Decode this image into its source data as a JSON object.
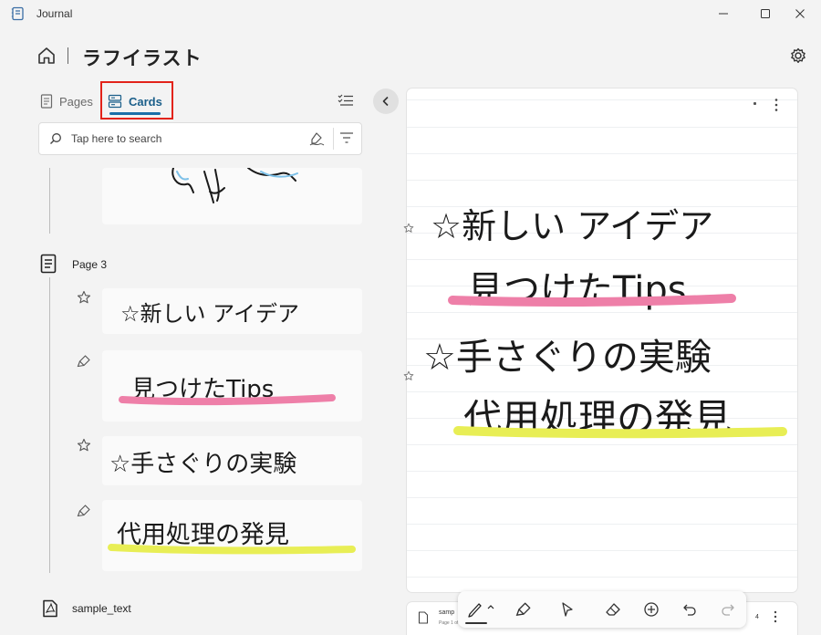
{
  "window": {
    "app_title": "Journal",
    "icons": [
      "journal-app-icon",
      "minimize-icon",
      "maximize-icon",
      "close-icon"
    ]
  },
  "header": {
    "notebook_title": "ラフイラスト",
    "icons": [
      "home-icon",
      "settings-icon"
    ]
  },
  "tabs": {
    "pages_label": "Pages",
    "cards_label": "Cards",
    "active": "Cards",
    "highlight_color": "#e2231a",
    "accent_color": "#1b6fa8"
  },
  "search": {
    "placeholder": "Tap here to search",
    "value": ""
  },
  "left_list": {
    "page_label": "Page 3",
    "cards": [
      {
        "marker": "star",
        "ink_text": "☆新しい アイデア"
      },
      {
        "marker": "highlighter",
        "ink_text": "見つけたTips",
        "underline_color": "#ee7fa8"
      },
      {
        "marker": "star",
        "ink_text": "☆手さぐりの実験"
      },
      {
        "marker": "highlighter",
        "ink_text": "代用処理の発見",
        "underline_color": "#e8ee55"
      }
    ],
    "pdf_label": "sample_text"
  },
  "note_page": {
    "lines": [
      {
        "ink_text": "☆新しい アイデア"
      },
      {
        "ink_text": "見つけたTips",
        "underline_color": "#ee7fa8"
      },
      {
        "ink_text": "☆手さぐりの実験"
      },
      {
        "ink_text": "代用処理の発見",
        "underline_color": "#e8ee55"
      }
    ]
  },
  "bottom_card": {
    "title": "samp",
    "subtitle": "Page 1 of 1",
    "page_number": "4"
  },
  "toolbar": {
    "tools": [
      "pen-icon",
      "highlighter-icon",
      "select-icon",
      "eraser-icon",
      "insert-icon",
      "undo-icon",
      "redo-icon"
    ],
    "active_tool": "pen-icon"
  }
}
